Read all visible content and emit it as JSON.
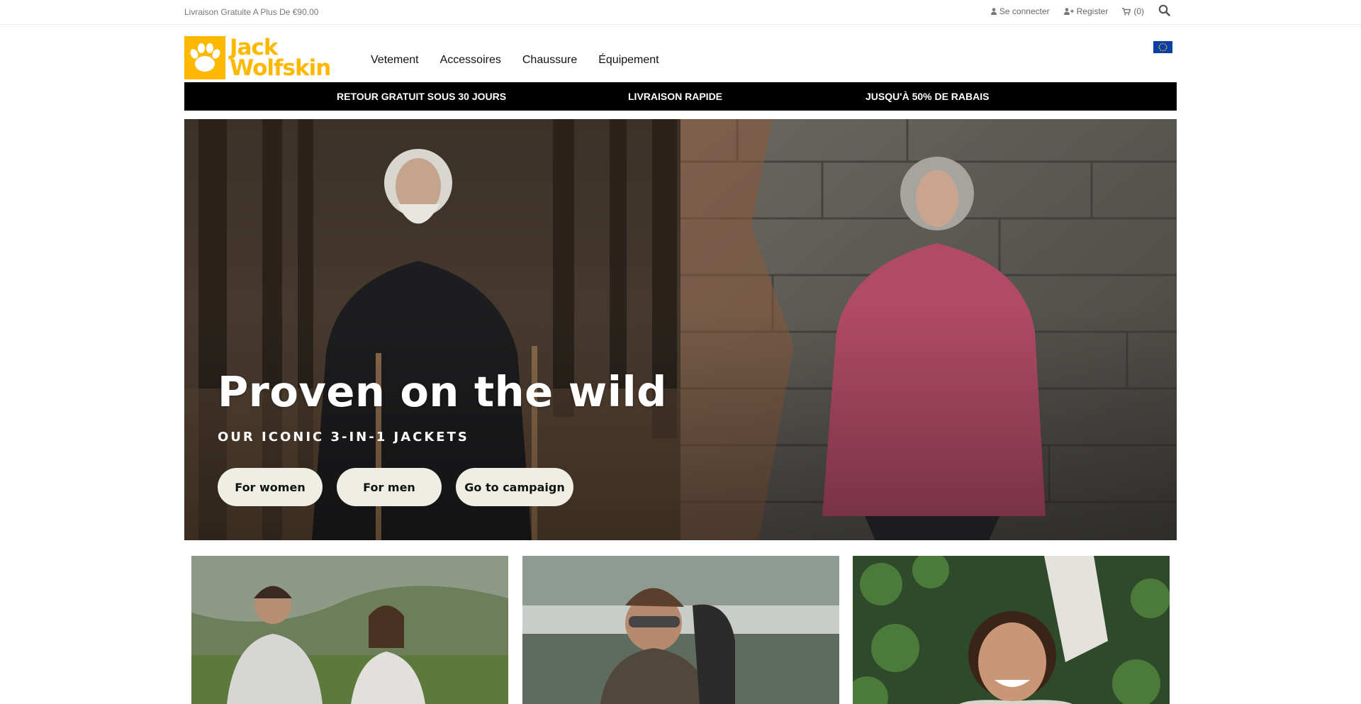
{
  "topbar": {
    "promo": "Livraison Gratuite A Plus De €90.00",
    "login": "Se connecter",
    "register": "Register",
    "cart": "(0)"
  },
  "header": {
    "logo_line1": "Jack",
    "logo_line2": "Wolfskin",
    "nav": [
      "Vetement",
      "Accessoires",
      "Chaussure",
      "Équipement"
    ]
  },
  "benefits": [
    "RETOUR GRATUIT SOUS 30 JOURS",
    "LIVRAISON RAPIDE",
    "JUSQU'À 50% DE RABAIS"
  ],
  "hero": {
    "title": "Proven on the wild",
    "subtitle": "OUR ICONIC 3-IN-1 JACKETS",
    "buttons": [
      "For women",
      "For men",
      "Go to campaign"
    ]
  },
  "colors": {
    "brand_yellow": "#ffb800",
    "benefit_bar": "#000000",
    "button_bg": "#efeee4"
  }
}
